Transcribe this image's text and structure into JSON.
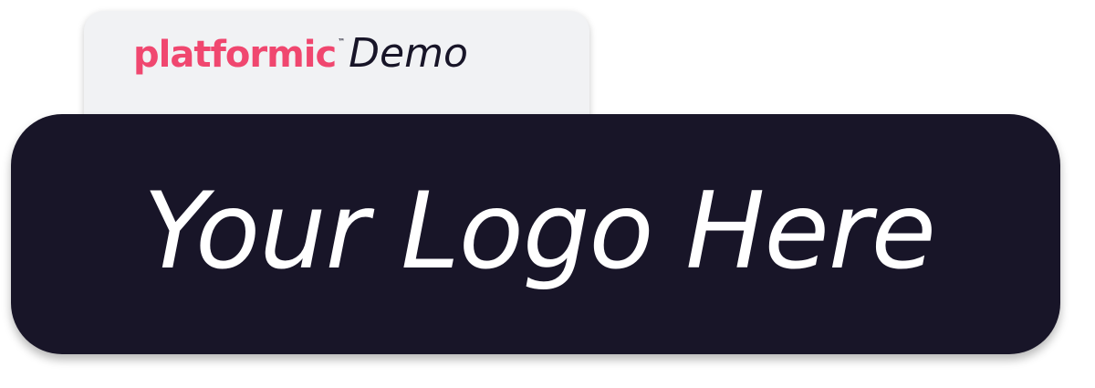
{
  "tab": {
    "brand_name": "platformic",
    "brand_trademark": "™",
    "demo_label": "Demo"
  },
  "banner": {
    "logo_placeholder": "Your Logo Here"
  },
  "colors": {
    "brand_pink": "#f0476f",
    "dark_navy": "#181528",
    "tab_background": "#f1f2f4",
    "banner_text": "#ffffff",
    "page_background": "#ffffff"
  }
}
